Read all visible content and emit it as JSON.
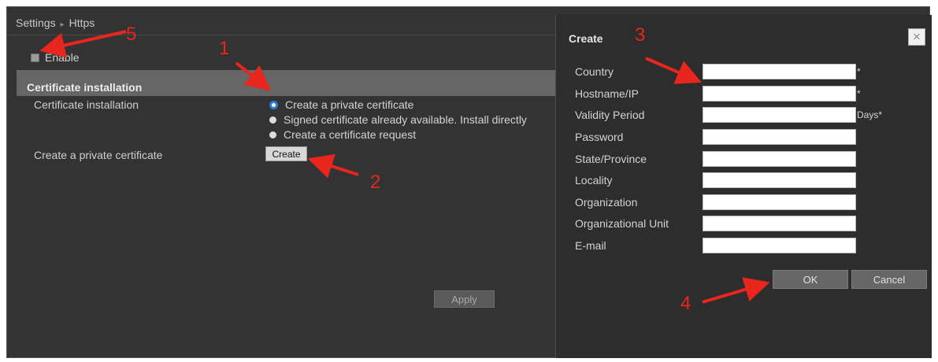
{
  "breadcrumb": {
    "root": "Settings",
    "separator": "▸",
    "current": "Https"
  },
  "enable": {
    "label": "Enable",
    "checked": false
  },
  "section": {
    "title": "Certificate installation"
  },
  "install_row": {
    "label": "Certificate installation",
    "options": [
      {
        "label": "Create a private certificate",
        "selected": true
      },
      {
        "label": "Signed certificate already available. Install directly",
        "selected": false
      },
      {
        "label": "Create a certificate request",
        "selected": false
      }
    ]
  },
  "private_row": {
    "label": "Create a private certificate",
    "button_label": "Create"
  },
  "apply_label": "Apply",
  "dialog": {
    "title": "Create",
    "close_glyph": "×",
    "fields": [
      {
        "label": "Country",
        "value": "",
        "suffix": "*"
      },
      {
        "label": "Hostname/IP",
        "value": "",
        "suffix": "*"
      },
      {
        "label": "Validity Period",
        "value": "",
        "suffix": "Days*"
      },
      {
        "label": "Password",
        "value": "",
        "suffix": ""
      },
      {
        "label": "State/Province",
        "value": "",
        "suffix": ""
      },
      {
        "label": "Locality",
        "value": "",
        "suffix": ""
      },
      {
        "label": "Organization",
        "value": "",
        "suffix": ""
      },
      {
        "label": "Organizational Unit",
        "value": "",
        "suffix": ""
      },
      {
        "label": "E-mail",
        "value": "",
        "suffix": ""
      }
    ],
    "ok_label": "OK",
    "cancel_label": "Cancel"
  },
  "annotations": [
    "1",
    "2",
    "3",
    "4",
    "5"
  ],
  "colors": {
    "annotation": "#e8261e",
    "radio_selected": "#2e7bd6",
    "background": "#333333"
  }
}
